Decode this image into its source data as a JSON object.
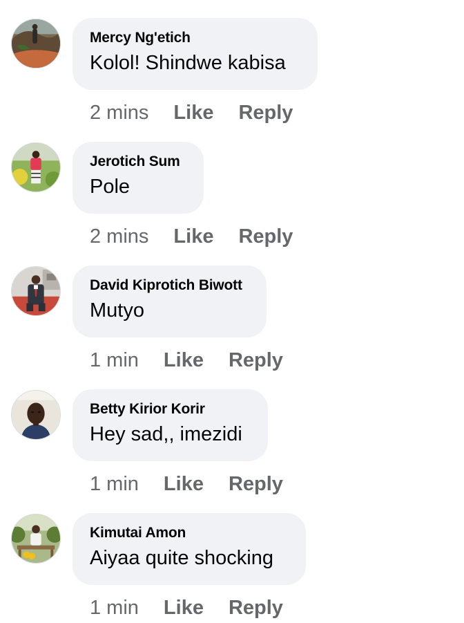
{
  "comments": [
    {
      "author": "Mercy Ng'etich",
      "text": "Kolol! Shindwe kabisa",
      "time": "2 mins",
      "like_label": "Like",
      "reply_label": "Reply",
      "avatar": "avatar-outdoor-rocks"
    },
    {
      "author": "Jerotich Sum",
      "text": "Pole",
      "time": "2 mins",
      "like_label": "Like",
      "reply_label": "Reply",
      "avatar": "avatar-garden-pink-top"
    },
    {
      "author": "David Kiprotich Biwott",
      "text": "Mutyo",
      "time": "1 min",
      "like_label": "Like",
      "reply_label": "Reply",
      "avatar": "avatar-man-in-suit"
    },
    {
      "author": "Betty Kirior Korir",
      "text": "Hey sad,, imezidi",
      "time": "1 min",
      "like_label": "Like",
      "reply_label": "Reply",
      "avatar": "avatar-selfie"
    },
    {
      "author": "Kimutai Amon",
      "text": "Aiyaa quite shocking",
      "time": "1 min",
      "like_label": "Like",
      "reply_label": "Reply",
      "avatar": "avatar-seated-outdoors"
    }
  ],
  "colors": {
    "bubble_bg": "#f0f2f5",
    "name_text": "#050505",
    "meta_text": "#65676b"
  }
}
